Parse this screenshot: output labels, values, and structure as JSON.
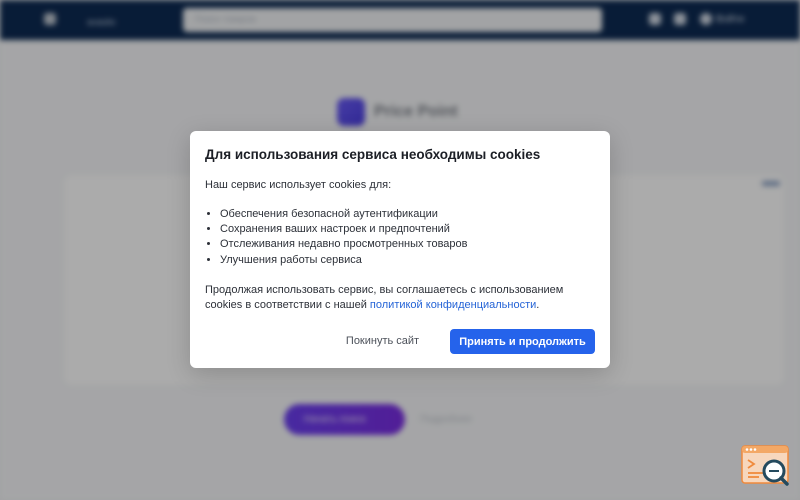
{
  "background": {
    "brand": "avasito",
    "search_placeholder": "Поиск товаров",
    "user_label": "Войти",
    "hero_title": "Price Point",
    "primary_cta": "Начать поиск",
    "secondary_cta": "Подробнее"
  },
  "cookie_modal": {
    "title": "Для использования сервиса необходимы cookies",
    "intro": "Наш сервис использует cookies для:",
    "purposes": [
      "Обеспечения безопасной аутентификации",
      "Сохранения ваших настроек и предпочтений",
      "Отслеживания недавно просмотренных товаров",
      "Улучшения работы сервиса"
    ],
    "outro_prefix": "Продолжая использовать сервис, вы соглашаетесь с использованием cookies в соответствии с нашей ",
    "policy_link": "политикой конфиденциальности",
    "outro_suffix": ".",
    "leave_button": "Покинуть сайт",
    "accept_button": "Принять и продолжить"
  },
  "colors": {
    "accent": "#2563eb",
    "topbar": "#0d2a52",
    "link": "#2463d6"
  },
  "icons": {
    "corner_widget": "search-document-icon"
  }
}
